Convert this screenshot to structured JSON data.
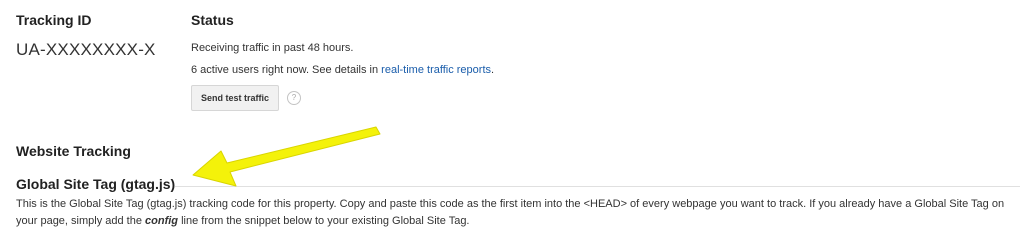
{
  "tracking": {
    "heading": "Tracking ID",
    "id_value": "UA-XXXXXXXX-X"
  },
  "status": {
    "heading": "Status",
    "line1": "Receiving traffic in past 48 hours.",
    "line2_prefix": "6 active users right now. See details in ",
    "line2_link": "real-time traffic reports",
    "line2_suffix": ".",
    "test_button_label": "Send test traffic",
    "help_glyph": "?"
  },
  "website_tracking": {
    "heading": "Website Tracking"
  },
  "global_site_tag": {
    "heading": "Global Site Tag (gtag.js)",
    "description_part1": "This is the Global Site Tag (gtag.js) tracking code for this property. Copy and paste this code as the first item into the <HEAD> of every webpage you want to track. If you already have a Global Site Tag on your page, simply add the ",
    "description_emphasis": "config",
    "description_part2": " line from the snippet below to your existing Global Site Tag."
  },
  "annotation": {
    "arrow_color": "#f4f20a",
    "arrow_stroke": "#d9d500",
    "icon": "pointer-arrow"
  },
  "colors": {
    "link": "#1a5dab",
    "text": "#333333",
    "heading": "#222222"
  }
}
